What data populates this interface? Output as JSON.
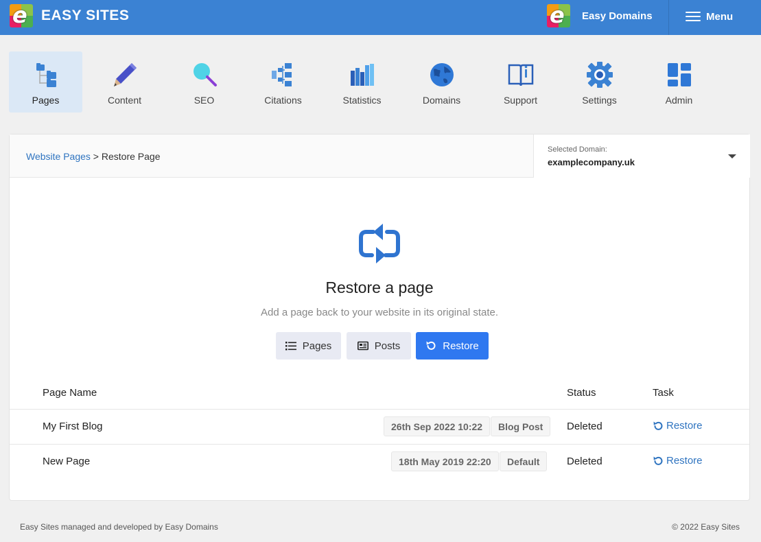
{
  "header": {
    "brand": "EASY SITES",
    "domains_link": "Easy Domains",
    "menu_label": "Menu"
  },
  "nav": {
    "items": [
      {
        "label": "Pages",
        "icon": "pages-tree-icon",
        "active": true
      },
      {
        "label": "Content",
        "icon": "pencil-icon"
      },
      {
        "label": "SEO",
        "icon": "magnifier-icon"
      },
      {
        "label": "Citations",
        "icon": "citations-icon"
      },
      {
        "label": "Statistics",
        "icon": "bar-chart-icon"
      },
      {
        "label": "Domains",
        "icon": "globe-icon"
      },
      {
        "label": "Support",
        "icon": "book-icon"
      },
      {
        "label": "Settings",
        "icon": "gear-icon"
      },
      {
        "label": "Admin",
        "icon": "dashboard-icon"
      }
    ]
  },
  "breadcrumb": {
    "parent": "Website Pages",
    "separator": ">",
    "current": "Restore Page"
  },
  "domain_selector": {
    "caption": "Selected Domain:",
    "value": "examplecompany.uk"
  },
  "hero": {
    "title": "Restore a page",
    "subtitle": "Add a page back to your website in its original state."
  },
  "buttons": {
    "pages": "Pages",
    "posts": "Posts",
    "restore": "Restore"
  },
  "table": {
    "headers": {
      "name": "Page Name",
      "status": "Status",
      "task": "Task"
    },
    "rows": [
      {
        "name": "My First Blog",
        "date": "26th Sep 2022 10:22",
        "type": "Blog Post",
        "status": "Deleted",
        "task": "Restore"
      },
      {
        "name": "New Page",
        "date": "18th May 2019 22:20",
        "type": "Default",
        "status": "Deleted",
        "task": "Restore"
      }
    ]
  },
  "footer": {
    "left": "Easy Sites managed and developed by Easy Domains",
    "right": "© 2022 Easy Sites"
  },
  "colors": {
    "header_bg": "#3b82d3",
    "primary": "#2f78f0",
    "link": "#2f74c0"
  }
}
